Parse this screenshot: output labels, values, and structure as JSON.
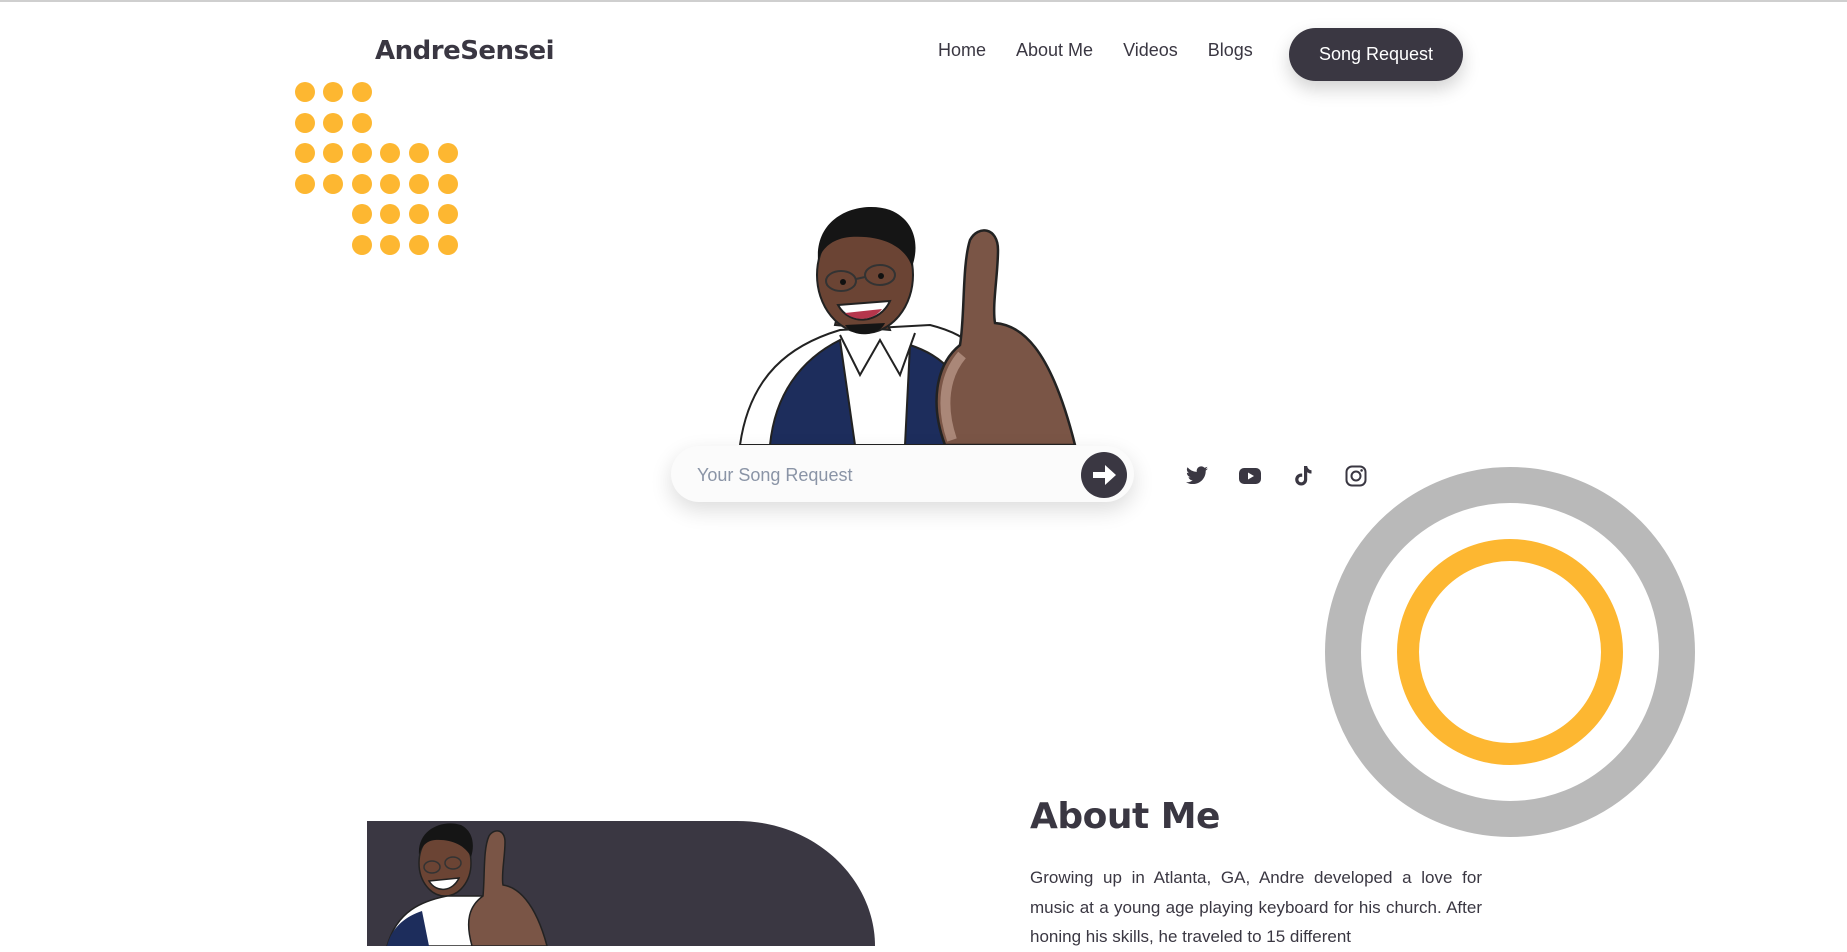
{
  "brand": {
    "logo": "AndreSensei"
  },
  "nav": {
    "items": [
      "Home",
      "About Me",
      "Videos",
      "Blogs"
    ],
    "cta": "Song Request"
  },
  "search": {
    "placeholder": "Your Song Request",
    "submit_icon": "arrow-right-icon"
  },
  "socials": [
    "twitter-icon",
    "youtube-icon",
    "tiktok-icon",
    "instagram-icon"
  ],
  "about": {
    "title": "About Me",
    "text": "Growing up in Atlanta, GA, Andre developed a love for music at a young age playing keyboard for his church. After honing his skills, he traveled to 15 different"
  },
  "colors": {
    "primary": "#3a3742",
    "accent": "#fdb731",
    "ring": "#b9b9b9",
    "background": "#ffffff"
  }
}
